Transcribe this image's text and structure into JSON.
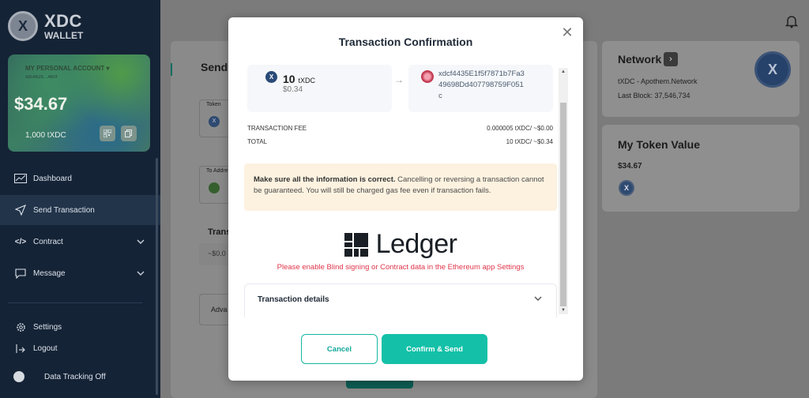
{
  "brand": {
    "coin_symbol": "X",
    "name": "XDC",
    "sub": "WALLET"
  },
  "account_card": {
    "name": "MY PERSONAL ACCOUNT",
    "address": "xdc4829…4b0f",
    "balance": "$34.67",
    "tokens": "1,000 tXDC"
  },
  "sidebar": {
    "items": [
      {
        "label": "Dashboard",
        "icon": "chart-line-icon"
      },
      {
        "label": "Send Transaction",
        "icon": "paper-plane-icon"
      },
      {
        "label": "Contract",
        "icon": "code-icon"
      },
      {
        "label": "Message",
        "icon": "message-icon"
      }
    ],
    "bottom": [
      {
        "label": "Settings",
        "icon": "gear-icon"
      },
      {
        "label": "Logout",
        "icon": "logout-icon"
      },
      {
        "label": "Data Tracking Off",
        "icon": "toggle-icon"
      }
    ]
  },
  "background_form": {
    "title": "Send",
    "token_label": "Token",
    "to_label": "To Address",
    "amount_label": "Trans",
    "amount_value": "~$0.0",
    "advanced_label": "Adva"
  },
  "network": {
    "title": "Network",
    "name": "tXDC - Apothem.Network",
    "last_block": "Last Block: 37,546,734"
  },
  "token_value": {
    "title": "My Token Value",
    "value": "$34.67"
  },
  "modal": {
    "title": "Transaction Confirmation",
    "from": {
      "amount": "10",
      "unit": "tXDC",
      "usd": "$0.34"
    },
    "to_address": "xdcf4435E1f5f7871b7Fa349698Dd407798759F051c",
    "fee_label": "TRANSACTION FEE",
    "fee_value": "0.000005 tXDC/ ~$0.00",
    "total_label": "TOTAL",
    "total_value": "10 tXDC/ ~$0.34",
    "warning_bold": "Make sure all the information is correct.",
    "warning_text": " Cancelling or reversing a transaction cannot be guaranteed. You will still be charged gas fee even if transaction fails.",
    "ledger_word": "Ledger",
    "ledger_error": "Please enable Blind signing or Contract data in the Ethereum app Settings",
    "details_label": "Transaction details",
    "cancel": "Cancel",
    "confirm": "Confirm & Send"
  },
  "colors": {
    "accent": "#14c0a8",
    "sidebar": "#152336",
    "error": "#e0354a",
    "warning_bg": "#fdf2e0"
  }
}
